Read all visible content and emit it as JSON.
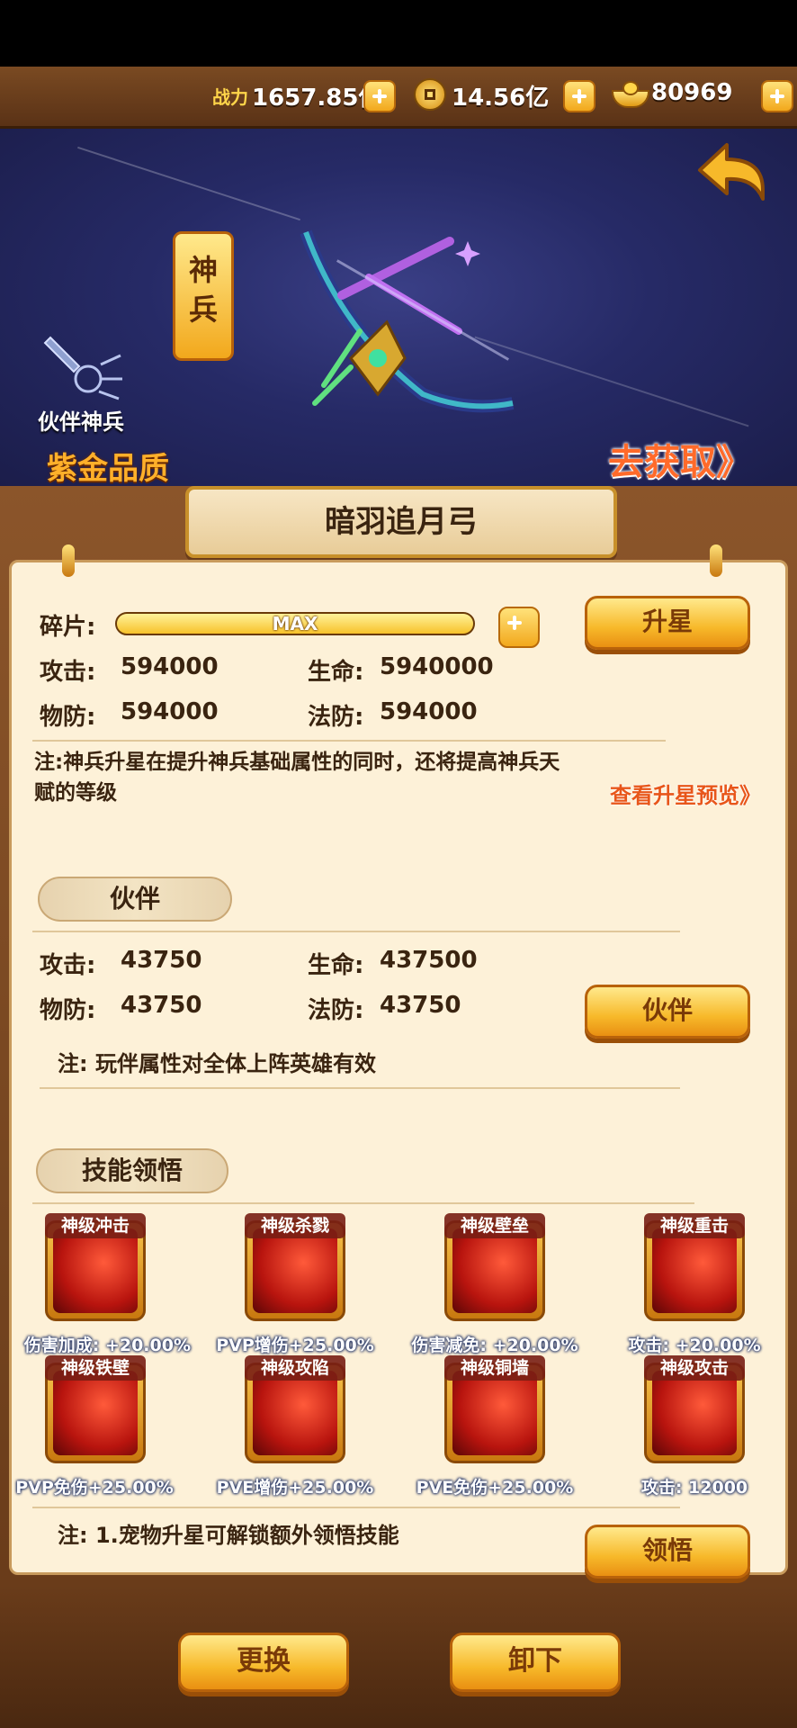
{
  "currency": {
    "power_label": "战力",
    "power_value": "1657.85亿",
    "coin_value": "14.56亿",
    "ingot_value": "80969"
  },
  "banner": {
    "badge_text": "神兵",
    "category_label": "伙伴神兵",
    "quality_label": "紫金品质",
    "obtain_link": "去获取》"
  },
  "weapon": {
    "name": "暗羽追月弓",
    "fragment_label": "碎片:",
    "fragment_progress": 1.0,
    "fragment_text": "MAX",
    "upgrade_button": "升星",
    "stats": [
      {
        "label": "攻击:",
        "value": "594000"
      },
      {
        "label": "生命:",
        "value": "5940000"
      },
      {
        "label": "物防:",
        "value": "594000"
      },
      {
        "label": "法防:",
        "value": "594000"
      }
    ],
    "note": "注:神兵升星在提升神兵基础属性的同时，还将提高神兵天赋的等级",
    "preview_link": "查看升星预览》"
  },
  "partner": {
    "section_title": "伙伴",
    "stats": [
      {
        "label": "攻击:",
        "value": "43750"
      },
      {
        "label": "生命:",
        "value": "437500"
      },
      {
        "label": "物防:",
        "value": "43750"
      },
      {
        "label": "法防:",
        "value": "43750"
      }
    ],
    "button": "伙伴",
    "note": "注: 玩伴属性对全体上阵英雄有效"
  },
  "skills": {
    "section_title": "技能领悟",
    "items": [
      {
        "name": "神级冲击",
        "value": "伤害加成: +20.00%"
      },
      {
        "name": "神级杀戮",
        "value": "PVP增伤+25.00%"
      },
      {
        "name": "神级壁垒",
        "value": "伤害减免: +20.00%"
      },
      {
        "name": "神级重击",
        "value": "攻击: +20.00%"
      },
      {
        "name": "神级铁壁",
        "value": "PVP免伤+25.00%"
      },
      {
        "name": "神级攻陷",
        "value": "PVE增伤+25.00%"
      },
      {
        "name": "神级铜墙",
        "value": "PVE免伤+25.00%"
      },
      {
        "name": "神级攻击",
        "value": "攻击: 12000"
      }
    ],
    "note": "注: 1.宠物升星可解锁额外领悟技能",
    "button": "领悟"
  },
  "footer": {
    "replace_button": "更换",
    "unequip_button": "卸下"
  },
  "colors": {
    "gold": "#f7b92a",
    "brown": "#6a3c1a",
    "paper": "#fdf1d8",
    "banner": "#262a66"
  }
}
